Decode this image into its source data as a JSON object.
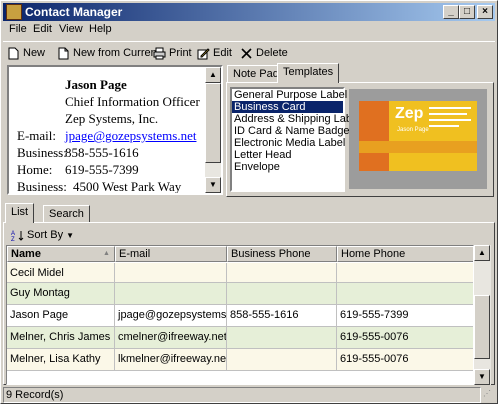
{
  "window": {
    "title": "Contact Manager"
  },
  "menu": [
    "File",
    "Edit",
    "View",
    "Help"
  ],
  "toolbar": {
    "new": "New",
    "new_from_current": "New from Current",
    "print": "Print",
    "edit": "Edit",
    "delete": "Delete"
  },
  "card": {
    "name": "Jason Page",
    "job_title": "Chief Information Officer",
    "company": "Zep Systems, Inc.",
    "email_label": "E-mail:",
    "email": "jpage@gozepsystems.net",
    "business_label": "Business:",
    "business_phone": "858-555-1616",
    "home_label": "Home:",
    "home_phone": "619-555-7399",
    "address_label": "Business:",
    "address": "4500 West Park Way"
  },
  "right_tabs": {
    "notepad": "Note Pad",
    "templates": "Templates"
  },
  "templates": [
    "General Purpose Label",
    "Business Card",
    "Address & Shipping Label",
    "ID Card & Name Badge",
    "Electronic Media Label",
    "Letter Head",
    "Envelope"
  ],
  "templates_selected": "Business Card",
  "preview": {
    "brand": "Zep",
    "name": "Jason Page"
  },
  "bottom_tabs": {
    "list": "List",
    "search": "Search"
  },
  "sort_by": "Sort By",
  "columns": [
    "Name",
    "E-mail",
    "Business Phone",
    "Home Phone"
  ],
  "rows": [
    {
      "name": "Cecil Midel",
      "email": "",
      "business": "",
      "home": ""
    },
    {
      "name": "Guy Montag",
      "email": "",
      "business": "",
      "home": ""
    },
    {
      "name": "Jason Page",
      "email": "jpage@gozepsystems.net",
      "business": "858-555-1616",
      "home": "619-555-7399"
    },
    {
      "name": "Melner, Chris James",
      "email": "cmelner@ifreeway.net",
      "business": "",
      "home": "619-555-0076"
    },
    {
      "name": "Melner, Lisa Kathy",
      "email": "lkmelner@ifreeway.net",
      "business": "",
      "home": "619-555-0076"
    }
  ],
  "status": "9 Record(s)",
  "colors": {
    "title_start": "#0a246a",
    "selection": "#0a246a",
    "row_alt": "#e6efd8",
    "row_cream": "#fbf8e8",
    "link": "#0000ff"
  }
}
